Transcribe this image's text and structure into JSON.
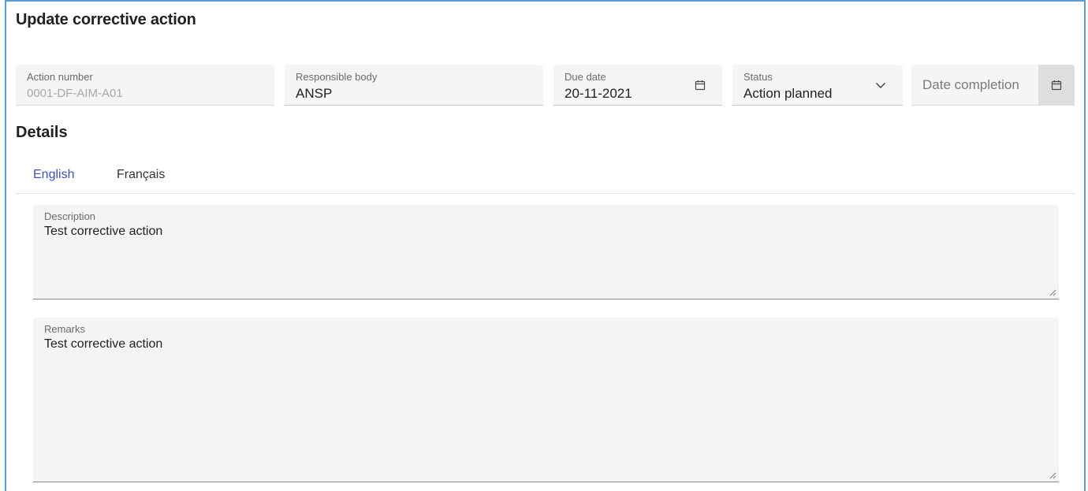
{
  "dialog": {
    "title": "Update corrective action"
  },
  "fields": {
    "action_number": {
      "label": "Action number",
      "value": "0001-DF-AIM-A01"
    },
    "responsible_body": {
      "label": "Responsible body",
      "value": "ANSP"
    },
    "due_date": {
      "label": "Due date",
      "value": "20-11-2021",
      "icon": "calendar-icon"
    },
    "status": {
      "label": "Status",
      "value": "Action planned",
      "icon": "chevron-down-icon"
    },
    "date_completion": {
      "placeholder": "Date completion",
      "icon": "calendar-icon"
    }
  },
  "details": {
    "title": "Details",
    "tabs": [
      {
        "label": "English",
        "active": true
      },
      {
        "label": "Français",
        "active": false
      }
    ],
    "description": {
      "label": "Description",
      "value": "Test corrective action"
    },
    "remarks": {
      "label": "Remarks",
      "value": "Test corrective action"
    }
  },
  "colors": {
    "accent": "#3f51b5",
    "frame": "#5b9bd5",
    "field_bg": "#f5f5f5"
  }
}
